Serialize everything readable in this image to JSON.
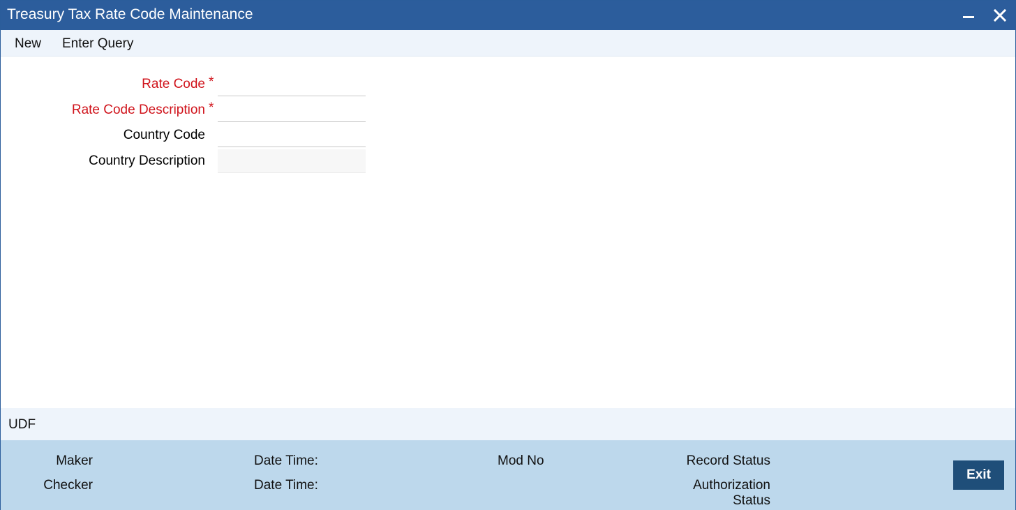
{
  "window": {
    "title": "Treasury Tax Rate Code Maintenance"
  },
  "menu": {
    "new_label": "New",
    "enter_query_label": "Enter Query"
  },
  "form": {
    "rate_code": {
      "label": "Rate Code",
      "required": true,
      "value": ""
    },
    "rate_code_description": {
      "label": "Rate Code Description",
      "required": true,
      "value": ""
    },
    "country_code": {
      "label": "Country Code",
      "value": ""
    },
    "country_description": {
      "label": "Country Description",
      "value": ""
    },
    "required_marker": "*"
  },
  "udf": {
    "label": "UDF"
  },
  "footer": {
    "maker_label": "Maker",
    "checker_label": "Checker",
    "date_time_label_1": "Date Time:",
    "date_time_label_2": "Date Time:",
    "mod_no_label": "Mod No",
    "record_status_label": "Record Status",
    "authorization_status_label": "Authorization Status",
    "exit_label": "Exit"
  },
  "colors": {
    "titlebar": "#2c5d9c",
    "required": "#d0131b",
    "footer": "#bdd8ec",
    "exit_button": "#1f4e79"
  },
  "icons": [
    "minimize-icon",
    "close-icon"
  ]
}
